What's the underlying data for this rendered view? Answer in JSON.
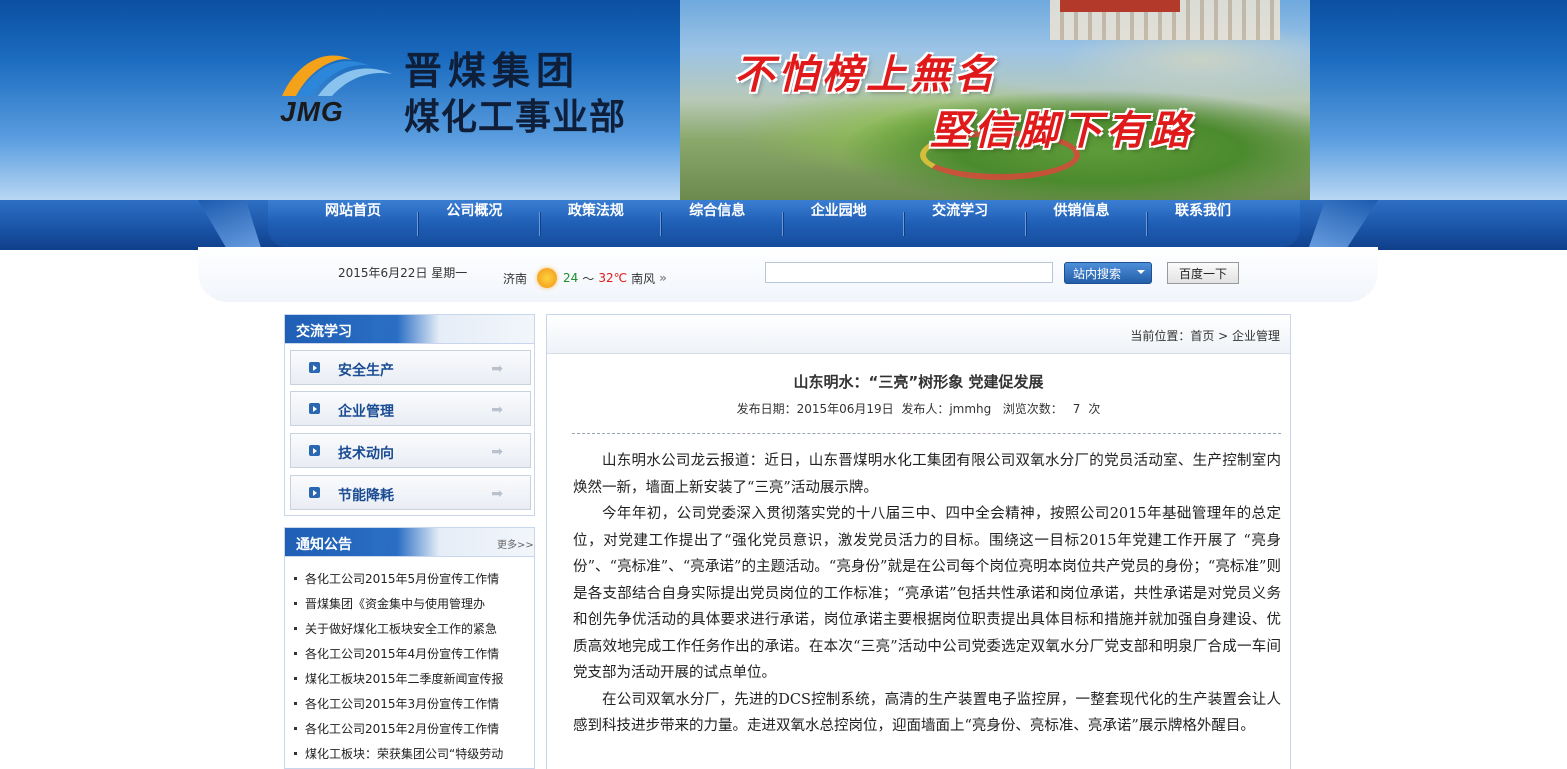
{
  "header": {
    "logo_letters": "JMG",
    "company_name": "晋煤集团",
    "division_name": "煤化工事业部",
    "slogan_line1": "不怕榜上無名",
    "slogan_line2": "堅信脚下有路"
  },
  "nav": {
    "items": [
      {
        "label": "网站首页"
      },
      {
        "label": "公司概况"
      },
      {
        "label": "政策法规"
      },
      {
        "label": "综合信息"
      },
      {
        "label": "企业园地"
      },
      {
        "label": "交流学习"
      },
      {
        "label": "供销信息"
      },
      {
        "label": "联系我们"
      }
    ]
  },
  "infobar": {
    "date": "2015年6月22日 星期一",
    "weather": {
      "city": "济南",
      "temp_low": "24",
      "sep": "～",
      "temp_high": "32℃",
      "wind": "南风",
      "more": "»",
      "icon": "sunny-icon"
    },
    "search": {
      "value": "",
      "placeholder": ""
    },
    "site_search_label": "站内搜索",
    "baidu_label": "百度一下"
  },
  "sidebar": {
    "category_title": "交流学习",
    "categories": [
      {
        "label": "安全生产"
      },
      {
        "label": "企业管理"
      },
      {
        "label": "技术动向"
      },
      {
        "label": "节能降耗"
      }
    ],
    "notice_title": "通知公告",
    "more_label": "更多>>",
    "notices": [
      {
        "text": "各化工公司2015年5月份宣传工作情"
      },
      {
        "text": "晋煤集团《资金集中与使用管理办"
      },
      {
        "text": "关于做好煤化工板块安全工作的紧急"
      },
      {
        "text": "各化工公司2015年4月份宣传工作情"
      },
      {
        "text": "煤化工板块2015年二季度新闻宣传报"
      },
      {
        "text": "各化工公司2015年3月份宣传工作情"
      },
      {
        "text": "各化工公司2015年2月份宣传工作情"
      },
      {
        "text": "煤化工板块：荣获集团公司“特级劳动"
      }
    ]
  },
  "article": {
    "breadcrumb": "当前位置：首页 > 企业管理",
    "title": "山东明水：“三亮”树形象 党建促发展",
    "meta": {
      "date_label": "发布日期：",
      "date": "2015年06月19日",
      "author_label": "发布人：",
      "author": "jmmhg",
      "views_label": "浏览次数：",
      "views": "7",
      "views_unit": "次"
    },
    "paragraphs": [
      "山东明水公司龙云报道：近日，山东晋煤明水化工集团有限公司双氧水分厂的党员活动室、生产控制室内焕然一新，墙面上新安装了“三亮”活动展示牌。",
      "今年年初，公司党委深入贯彻落实党的十八届三中、四中全会精神，按照公司2015年基础管理年的总定位，对党建工作提出了“强化党员意识，激发党员活力的目标。围绕这一目标2015年党建工作开展了 “亮身份”、“亮标准”、“亮承诺”的主题活动。“亮身份”就是在公司每个岗位亮明本岗位共产党员的身份；“亮标准”则是各支部结合自身实际提出党员岗位的工作标准；“亮承诺”包括共性承诺和岗位承诺，共性承诺是对党员义务和创先争优活动的具体要求进行承诺，岗位承诺主要根据岗位职责提出具体目标和措施并就加强自身建设、优质高效地完成工作任务作出的承诺。在本次“三亮”活动中公司党委选定双氧水分厂党支部和明泉厂合成一车间党支部为活动开展的试点单位。",
      "在公司双氧水分厂，先进的DCS控制系统，高清的生产装置电子监控屏，一整套现代化的生产装置会让人感到科技进步带来的力量。走进双氧水总控岗位，迎面墙面上“亮身份、亮标准、亮承诺”展示牌格外醒目。"
    ]
  }
}
